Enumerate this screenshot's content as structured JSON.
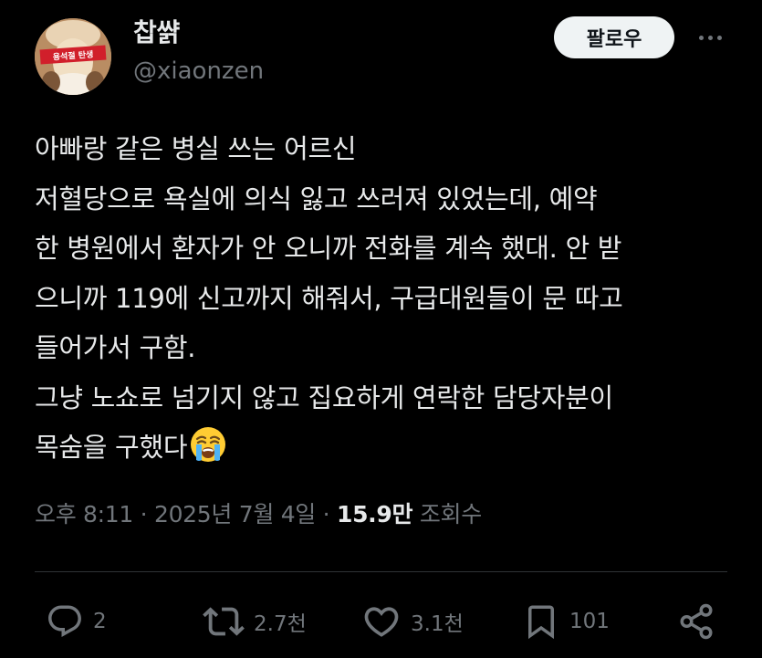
{
  "author": {
    "display_name": "찹쌹",
    "handle": "@xiaonzen",
    "avatar_banner_text": "용석절 탄생"
  },
  "header": {
    "follow_label": "팔로우",
    "more_icon": "more-horizontal-icon"
  },
  "tweet": {
    "lines": [
      "아빠랑 같은 병실 쓰는 어르신",
      "저혈당으로 욕실에 의식 잃고 쓰러져 있었는데, 예약",
      "한 병원에서 환자가 안 오니까 전화를 계속 했대. 안 받",
      "으니까 119에 신고까지 해줘서, 구급대원들이 문 따고",
      "들어가서 구함.",
      "그냥 노쇼로 넘기지 않고 집요하게 연락한 담당자분이",
      "목숨을 구했다"
    ],
    "emoji": "loudly-crying-face"
  },
  "meta": {
    "time": "오후 8:11",
    "separator": "·",
    "date": "2025년 7월 4일",
    "views_count": "15.9만",
    "views_label": "조회수"
  },
  "actions": {
    "reply_count": "2",
    "retweet_count": "2.7천",
    "like_count": "3.1천",
    "bookmark_count": "101"
  },
  "colors": {
    "background": "#000000",
    "text_primary": "#e7e9ea",
    "text_secondary": "#71767b",
    "divider": "#2f3336",
    "follow_button_bg": "#eff3f4"
  }
}
